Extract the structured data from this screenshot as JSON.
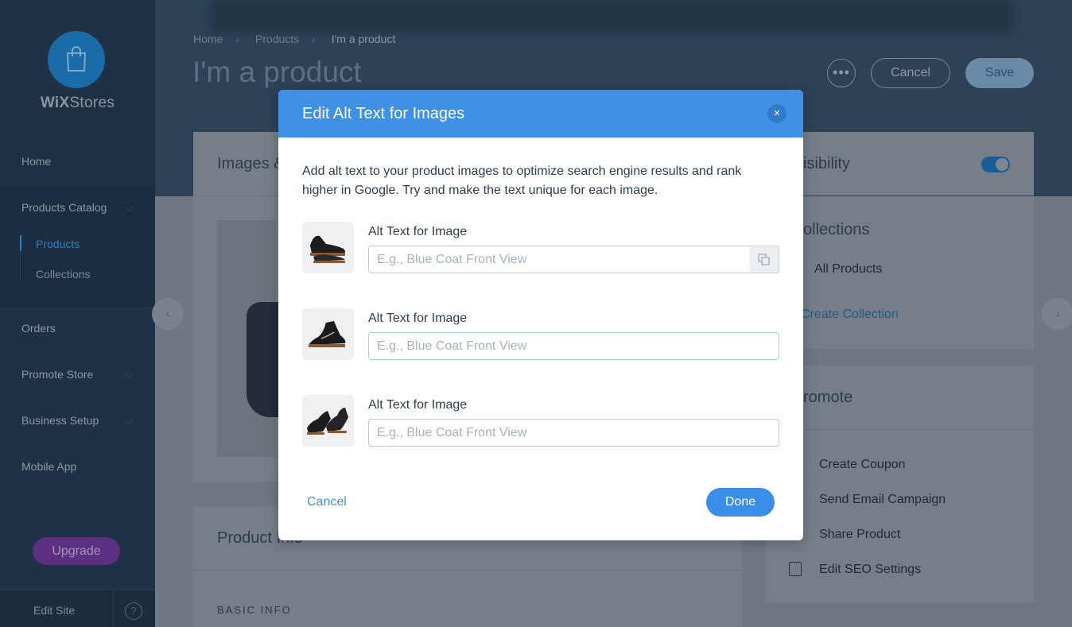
{
  "sidebar": {
    "brand_wix": "WiX",
    "brand_stores": "Stores",
    "items": {
      "home": "Home",
      "products_catalog": "Products Catalog",
      "products": "Products",
      "collections": "Collections",
      "orders": "Orders",
      "promote_store": "Promote Store",
      "business_setup": "Business Setup",
      "mobile_app": "Mobile App"
    },
    "upgrade_label": "Upgrade",
    "edit_site_label": "Edit Site",
    "help_glyph": "?"
  },
  "header": {
    "breadcrumb": [
      "Home",
      "Products",
      "I'm a product"
    ],
    "title": "I'm a product",
    "more_glyph": "•••",
    "cancel_label": "Cancel",
    "save_label": "Save"
  },
  "background_cards": {
    "images_heading": "Images &",
    "product_info_heading": "Product Info",
    "basic_info_label": "BASIC INFO",
    "visibility_heading": "isibility",
    "collections_heading": "ollections",
    "all_products": "All Products",
    "create_collection": "Create Collection",
    "promote_heading": "romote",
    "promote_items": [
      "Create Coupon",
      "Send Email Campaign",
      "Share Product",
      "Edit SEO Settings"
    ]
  },
  "modal": {
    "title": "Edit Alt Text for Images",
    "close_glyph": "×",
    "description": "Add alt text to your product images to optimize search engine results and rank higher in Google. Try and make the text unique for each image.",
    "rows": [
      {
        "label": "Alt Text for Image",
        "value": "",
        "placeholder": "E.g., Blue Coat Front View"
      },
      {
        "label": "Alt Text for Image",
        "value": "",
        "placeholder": "E.g., Blue Coat Front View"
      },
      {
        "label": "Alt Text for Image",
        "value": "",
        "placeholder": "E.g., Blue Coat Front View"
      }
    ],
    "cancel_label": "Cancel",
    "done_label": "Done"
  },
  "colors": {
    "accent": "#3e91e4",
    "sidebar_bg": "#1e3145",
    "upgrade": "#5b3080"
  }
}
